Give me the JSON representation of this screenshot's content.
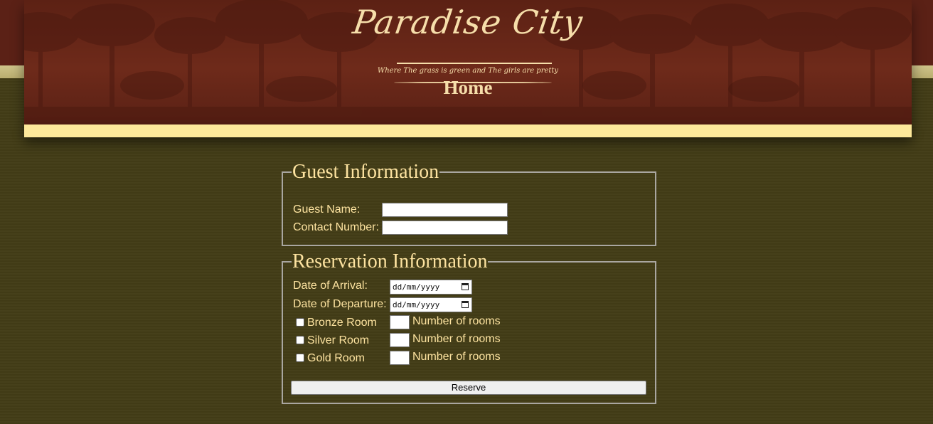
{
  "site": {
    "logo_title": "Paradise City",
    "tagline": "Where The grass is green and The girls are pretty",
    "page_heading": "Home"
  },
  "guest_section": {
    "legend": "Guest Information",
    "name_label": "Guest Name:",
    "name_value": "",
    "contact_label": "Contact Number:",
    "contact_value": ""
  },
  "reservation_section": {
    "legend": "Reservation Information",
    "arrival_label": "Date of Arrival:",
    "arrival_placeholder": "dd/mm/yyyy",
    "departure_label": "Date of Departure:",
    "departure_placeholder": "dd/mm/yyyy",
    "rooms": [
      {
        "label": "Bronze Room",
        "checked": false,
        "count_label": "Number of rooms"
      },
      {
        "label": "Silver Room",
        "checked": false,
        "count_label": "Number of rooms"
      },
      {
        "label": "Gold Room",
        "checked": false,
        "count_label": "Number of rooms"
      }
    ],
    "submit_label": "Reserve"
  },
  "colors": {
    "page_background": "#433d17",
    "header_background": "#6e2a1a",
    "header_strip": "#fde89a",
    "label_text": "#fde3a0",
    "fieldset_border": "#a9a6a0"
  }
}
